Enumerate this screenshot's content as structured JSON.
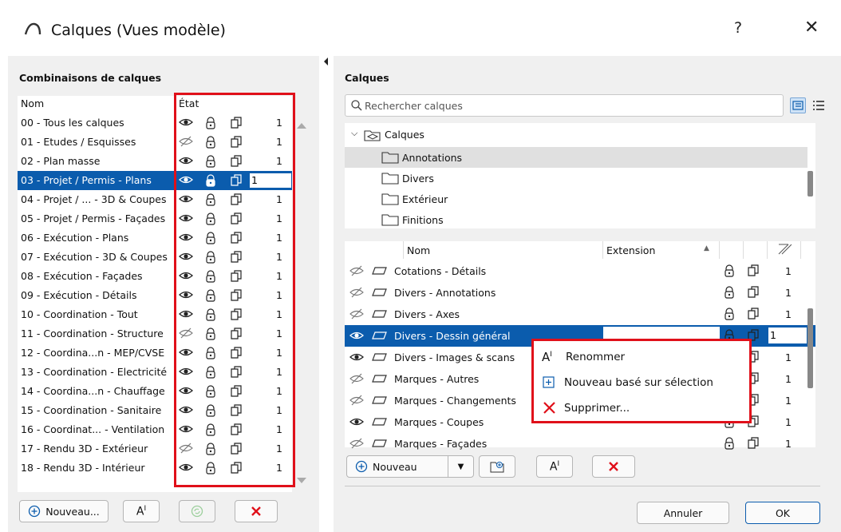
{
  "window": {
    "title": "Calques (Vues modèle)",
    "help_label": "?",
    "close_label": "✕"
  },
  "left_panel": {
    "title": "Combinaisons de calques",
    "col_name": "Nom",
    "col_state": "État",
    "rows": [
      {
        "name": "00 - Tous les calques",
        "visible": true,
        "num": "1"
      },
      {
        "name": "01 - Etudes / Esquisses",
        "visible": false,
        "num": "1"
      },
      {
        "name": "02 - Plan masse",
        "visible": true,
        "num": "1"
      },
      {
        "name": "03 - Projet / Permis - Plans",
        "visible": true,
        "num": "1",
        "selected": true
      },
      {
        "name": "04 - Projet / ... - 3D & Coupes",
        "visible": true,
        "num": "1"
      },
      {
        "name": "05 - Projet / Permis - Façades",
        "visible": true,
        "num": "1"
      },
      {
        "name": "06 - Exécution - Plans",
        "visible": true,
        "num": "1"
      },
      {
        "name": "07 - Exécution - 3D & Coupes",
        "visible": true,
        "num": "1"
      },
      {
        "name": "08 - Exécution - Façades",
        "visible": true,
        "num": "1"
      },
      {
        "name": "09 - Exécution - Détails",
        "visible": true,
        "num": "1"
      },
      {
        "name": "10 - Coordination - Tout",
        "visible": true,
        "num": "1"
      },
      {
        "name": "11 - Coordination - Structure",
        "visible": false,
        "num": "1"
      },
      {
        "name": "12 - Coordina...n - MEP/CVSE",
        "visible": true,
        "num": "1"
      },
      {
        "name": "13 - Coordination - Electricité",
        "visible": true,
        "num": "1"
      },
      {
        "name": "14 - Coordina...n - Chauffage",
        "visible": true,
        "num": "1"
      },
      {
        "name": "15 - Coordination - Sanitaire",
        "visible": true,
        "num": "1"
      },
      {
        "name": "16 - Coordinat... - Ventilation",
        "visible": true,
        "num": "1"
      },
      {
        "name": "17 - Rendu 3D - Extérieur",
        "visible": false,
        "num": "1"
      },
      {
        "name": "18 - Rendu 3D - Intérieur",
        "visible": true,
        "num": "1"
      }
    ],
    "new_button": "Nouveau..."
  },
  "right_panel": {
    "title": "Calques",
    "search_placeholder": "Rechercher calques",
    "tree_root": "Calques",
    "tree_items": [
      "Annotations",
      "Divers",
      "Extérieur",
      "Finitions"
    ],
    "col_name": "Nom",
    "col_extension": "Extension",
    "layers": [
      {
        "name": "Cotations - Détails",
        "visible": false,
        "num": "1"
      },
      {
        "name": "Divers - Annotations",
        "visible": false,
        "num": "1"
      },
      {
        "name": "Divers - Axes",
        "visible": false,
        "num": "1"
      },
      {
        "name": "Divers - Dessin général",
        "visible": true,
        "num": "1",
        "selected": true
      },
      {
        "name": "Divers - Images & scans",
        "visible": true,
        "num": "1"
      },
      {
        "name": "Marques - Autres",
        "visible": false,
        "num": "1"
      },
      {
        "name": "Marques - Changements",
        "visible": false,
        "num": "1"
      },
      {
        "name": "Marques - Coupes",
        "visible": true,
        "num": "1"
      },
      {
        "name": "Marques - Façades",
        "visible": false,
        "num": "1"
      }
    ],
    "new_button": "Nouveau"
  },
  "context_menu": {
    "rename": "Renommer",
    "new_from_selection": "Nouveau basé sur sélection",
    "delete": "Supprimer..."
  },
  "footer": {
    "cancel": "Annuler",
    "ok": "OK"
  },
  "colors": {
    "selection": "#0b5cad",
    "highlight_box": "#e0101a"
  }
}
